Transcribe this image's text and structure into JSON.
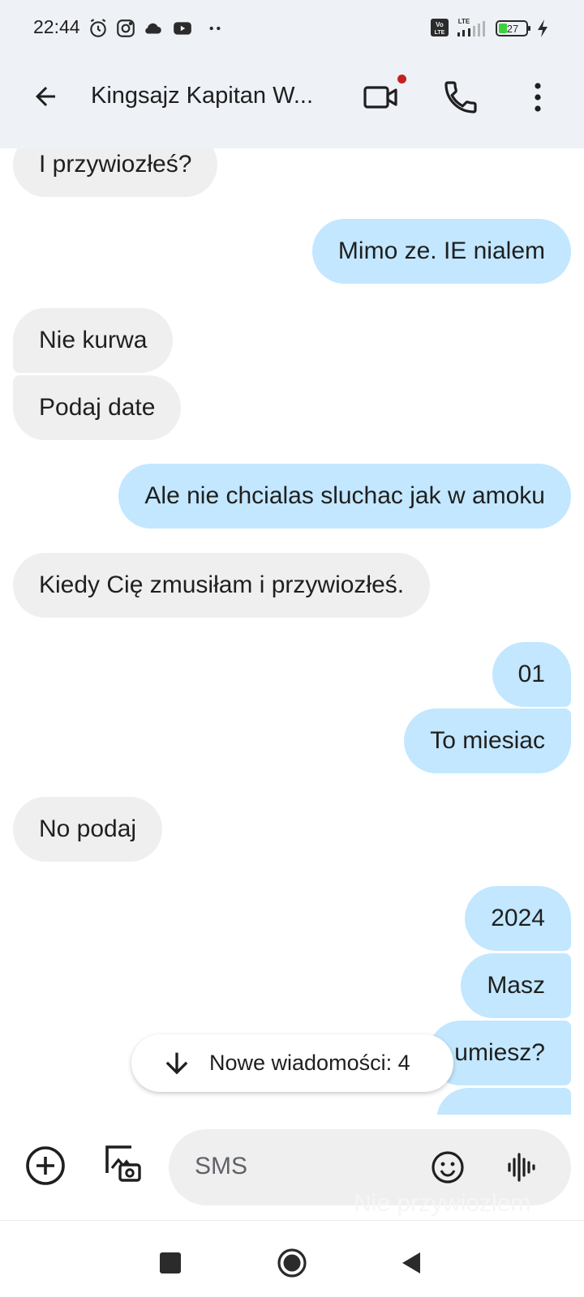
{
  "status_bar": {
    "time": "22:44",
    "icons": [
      "alarm-icon",
      "instagram-icon",
      "cloud-icon",
      "youtube-icon",
      "more-dots-icon"
    ],
    "right_icons": [
      "volte-icon",
      "lte-signal-icon",
      "battery-icon",
      "charging-icon"
    ],
    "network_label": "LTE",
    "volte_label": "Vo LTE",
    "battery": "27"
  },
  "app_bar": {
    "contact_name": "Kingsajz Kapitan W...",
    "video_call_has_badge": true
  },
  "messages": [
    {
      "dir": "in",
      "text": "I przywiozłeś?"
    },
    {
      "dir": "out",
      "text": "Mimo ze. IE nialem"
    },
    {
      "dir": "in",
      "text": "Nie kurwa"
    },
    {
      "dir": "in",
      "text": "Podaj date"
    },
    {
      "dir": "out",
      "text": "Ale nie chcialas sluchac jak w amoku"
    },
    {
      "dir": "in",
      "text": "Kiedy Cię zmusiłam i przywiozłeś."
    },
    {
      "dir": "out",
      "text": "01"
    },
    {
      "dir": "out",
      "text": "To miesiac"
    },
    {
      "dir": "in",
      "text": "No podaj"
    },
    {
      "dir": "out",
      "text": "2024"
    },
    {
      "dir": "out",
      "text": "Masz"
    },
    {
      "dir": "out",
      "text": "umiesz?"
    },
    {
      "dir": "out",
      "text": "Nie przywiozłem"
    }
  ],
  "new_messages_pill": {
    "label": "Nowe wiadomości: 4"
  },
  "compose": {
    "placeholder": "SMS"
  },
  "colors": {
    "header_bg": "#eef1f6",
    "incoming_bubble": "#efefef",
    "outgoing_bubble": "#c2e7ff",
    "badge": "#c5221f"
  }
}
